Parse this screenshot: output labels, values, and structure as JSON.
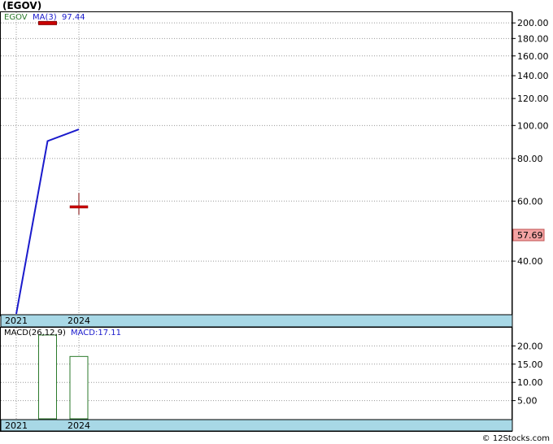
{
  "title": "(EGOV)",
  "credit": "© 12Stocks.com",
  "colors": {
    "ma_line": "#1a1acc",
    "price_bar": "#cc0000",
    "macd_bar_stroke": "#2b7a2b",
    "axis_band": "#a8d8e6",
    "last_price_box": "#f4a3a3"
  },
  "price_panel": {
    "legend": {
      "symbol": "EGOV",
      "ma_label": "MA(3)",
      "ma_value": "97.44"
    },
    "last_price": "57.69",
    "y_ticks": [
      "200.00",
      "180.00",
      "160.00",
      "140.00",
      "120.00",
      "100.00",
      "80.00",
      "60.00",
      "40.00"
    ],
    "x_labels": [
      "2021",
      "2024"
    ]
  },
  "macd_panel": {
    "legend": {
      "label": "MACD(26,12,9)",
      "value_label": "MACD:17.11"
    },
    "y_ticks": [
      "20.00",
      "15.00",
      "10.00",
      "5.00"
    ],
    "x_labels": [
      "2021",
      "2024"
    ]
  },
  "chart_data": [
    {
      "type": "line",
      "panel": "price",
      "scale": "log",
      "ylim": [
        28,
        215
      ],
      "series": [
        {
          "name": "MA(3)",
          "x": [
            0,
            1,
            2
          ],
          "values": [
            28,
            90,
            97.44
          ]
        }
      ],
      "price_bars": [
        {
          "x": 1,
          "high": 202,
          "low": 199
        },
        {
          "x": 2,
          "high": 60,
          "low": 56,
          "close": 57.69
        }
      ],
      "y_ticks": [
        200,
        180,
        160,
        140,
        120,
        100,
        80,
        60,
        40
      ],
      "x_labels": [
        "2021",
        "2024"
      ]
    },
    {
      "type": "bar",
      "panel": "macd",
      "ylim": [
        0,
        25
      ],
      "series": [
        {
          "name": "MACD(26,12,9)",
          "x": [
            1,
            2
          ],
          "values": [
            23,
            17.11
          ]
        }
      ],
      "y_ticks": [
        20,
        15,
        10,
        5
      ],
      "x_labels": [
        "2021",
        "2024"
      ]
    }
  ]
}
